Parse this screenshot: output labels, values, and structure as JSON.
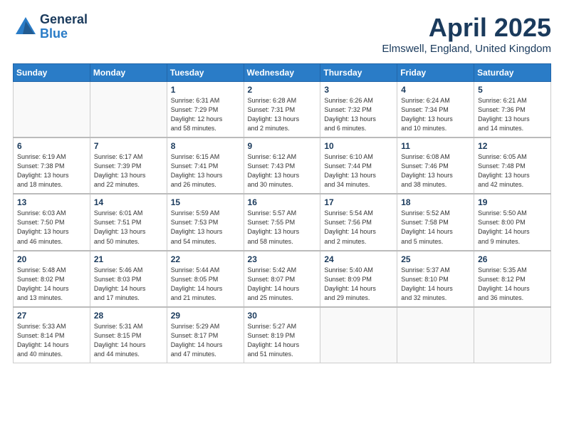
{
  "header": {
    "logo_general": "General",
    "logo_blue": "Blue",
    "month": "April 2025",
    "location": "Elmswell, England, United Kingdom"
  },
  "weekdays": [
    "Sunday",
    "Monday",
    "Tuesday",
    "Wednesday",
    "Thursday",
    "Friday",
    "Saturday"
  ],
  "weeks": [
    [
      {
        "day": "",
        "detail": ""
      },
      {
        "day": "",
        "detail": ""
      },
      {
        "day": "1",
        "detail": "Sunrise: 6:31 AM\nSunset: 7:29 PM\nDaylight: 12 hours\nand 58 minutes."
      },
      {
        "day": "2",
        "detail": "Sunrise: 6:28 AM\nSunset: 7:31 PM\nDaylight: 13 hours\nand 2 minutes."
      },
      {
        "day": "3",
        "detail": "Sunrise: 6:26 AM\nSunset: 7:32 PM\nDaylight: 13 hours\nand 6 minutes."
      },
      {
        "day": "4",
        "detail": "Sunrise: 6:24 AM\nSunset: 7:34 PM\nDaylight: 13 hours\nand 10 minutes."
      },
      {
        "day": "5",
        "detail": "Sunrise: 6:21 AM\nSunset: 7:36 PM\nDaylight: 13 hours\nand 14 minutes."
      }
    ],
    [
      {
        "day": "6",
        "detail": "Sunrise: 6:19 AM\nSunset: 7:38 PM\nDaylight: 13 hours\nand 18 minutes."
      },
      {
        "day": "7",
        "detail": "Sunrise: 6:17 AM\nSunset: 7:39 PM\nDaylight: 13 hours\nand 22 minutes."
      },
      {
        "day": "8",
        "detail": "Sunrise: 6:15 AM\nSunset: 7:41 PM\nDaylight: 13 hours\nand 26 minutes."
      },
      {
        "day": "9",
        "detail": "Sunrise: 6:12 AM\nSunset: 7:43 PM\nDaylight: 13 hours\nand 30 minutes."
      },
      {
        "day": "10",
        "detail": "Sunrise: 6:10 AM\nSunset: 7:44 PM\nDaylight: 13 hours\nand 34 minutes."
      },
      {
        "day": "11",
        "detail": "Sunrise: 6:08 AM\nSunset: 7:46 PM\nDaylight: 13 hours\nand 38 minutes."
      },
      {
        "day": "12",
        "detail": "Sunrise: 6:05 AM\nSunset: 7:48 PM\nDaylight: 13 hours\nand 42 minutes."
      }
    ],
    [
      {
        "day": "13",
        "detail": "Sunrise: 6:03 AM\nSunset: 7:50 PM\nDaylight: 13 hours\nand 46 minutes."
      },
      {
        "day": "14",
        "detail": "Sunrise: 6:01 AM\nSunset: 7:51 PM\nDaylight: 13 hours\nand 50 minutes."
      },
      {
        "day": "15",
        "detail": "Sunrise: 5:59 AM\nSunset: 7:53 PM\nDaylight: 13 hours\nand 54 minutes."
      },
      {
        "day": "16",
        "detail": "Sunrise: 5:57 AM\nSunset: 7:55 PM\nDaylight: 13 hours\nand 58 minutes."
      },
      {
        "day": "17",
        "detail": "Sunrise: 5:54 AM\nSunset: 7:56 PM\nDaylight: 14 hours\nand 2 minutes."
      },
      {
        "day": "18",
        "detail": "Sunrise: 5:52 AM\nSunset: 7:58 PM\nDaylight: 14 hours\nand 5 minutes."
      },
      {
        "day": "19",
        "detail": "Sunrise: 5:50 AM\nSunset: 8:00 PM\nDaylight: 14 hours\nand 9 minutes."
      }
    ],
    [
      {
        "day": "20",
        "detail": "Sunrise: 5:48 AM\nSunset: 8:02 PM\nDaylight: 14 hours\nand 13 minutes."
      },
      {
        "day": "21",
        "detail": "Sunrise: 5:46 AM\nSunset: 8:03 PM\nDaylight: 14 hours\nand 17 minutes."
      },
      {
        "day": "22",
        "detail": "Sunrise: 5:44 AM\nSunset: 8:05 PM\nDaylight: 14 hours\nand 21 minutes."
      },
      {
        "day": "23",
        "detail": "Sunrise: 5:42 AM\nSunset: 8:07 PM\nDaylight: 14 hours\nand 25 minutes."
      },
      {
        "day": "24",
        "detail": "Sunrise: 5:40 AM\nSunset: 8:09 PM\nDaylight: 14 hours\nand 29 minutes."
      },
      {
        "day": "25",
        "detail": "Sunrise: 5:37 AM\nSunset: 8:10 PM\nDaylight: 14 hours\nand 32 minutes."
      },
      {
        "day": "26",
        "detail": "Sunrise: 5:35 AM\nSunset: 8:12 PM\nDaylight: 14 hours\nand 36 minutes."
      }
    ],
    [
      {
        "day": "27",
        "detail": "Sunrise: 5:33 AM\nSunset: 8:14 PM\nDaylight: 14 hours\nand 40 minutes."
      },
      {
        "day": "28",
        "detail": "Sunrise: 5:31 AM\nSunset: 8:15 PM\nDaylight: 14 hours\nand 44 minutes."
      },
      {
        "day": "29",
        "detail": "Sunrise: 5:29 AM\nSunset: 8:17 PM\nDaylight: 14 hours\nand 47 minutes."
      },
      {
        "day": "30",
        "detail": "Sunrise: 5:27 AM\nSunset: 8:19 PM\nDaylight: 14 hours\nand 51 minutes."
      },
      {
        "day": "",
        "detail": ""
      },
      {
        "day": "",
        "detail": ""
      },
      {
        "day": "",
        "detail": ""
      }
    ]
  ]
}
